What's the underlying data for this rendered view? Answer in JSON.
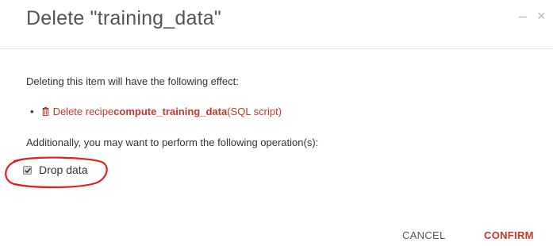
{
  "dialog": {
    "title": "Delete \"training_data\"",
    "minimize_symbol": "–",
    "close_symbol": "×"
  },
  "body": {
    "effect_intro": "Deleting this item will have the following effect:",
    "effects": [
      {
        "icon": "trash-icon",
        "prefix": "Delete recipe ",
        "name": "compute_training_data",
        "suffix": " (SQL script)"
      }
    ],
    "additional_text": "Additionally, you may want to perform the following operation(s):",
    "drop_data": {
      "label": "Drop data",
      "checked": true
    }
  },
  "footer": {
    "cancel_label": "CANCEL",
    "confirm_label": "CONFIRM"
  },
  "colors": {
    "accent": "#c0392b",
    "annotation": "#e02020"
  }
}
